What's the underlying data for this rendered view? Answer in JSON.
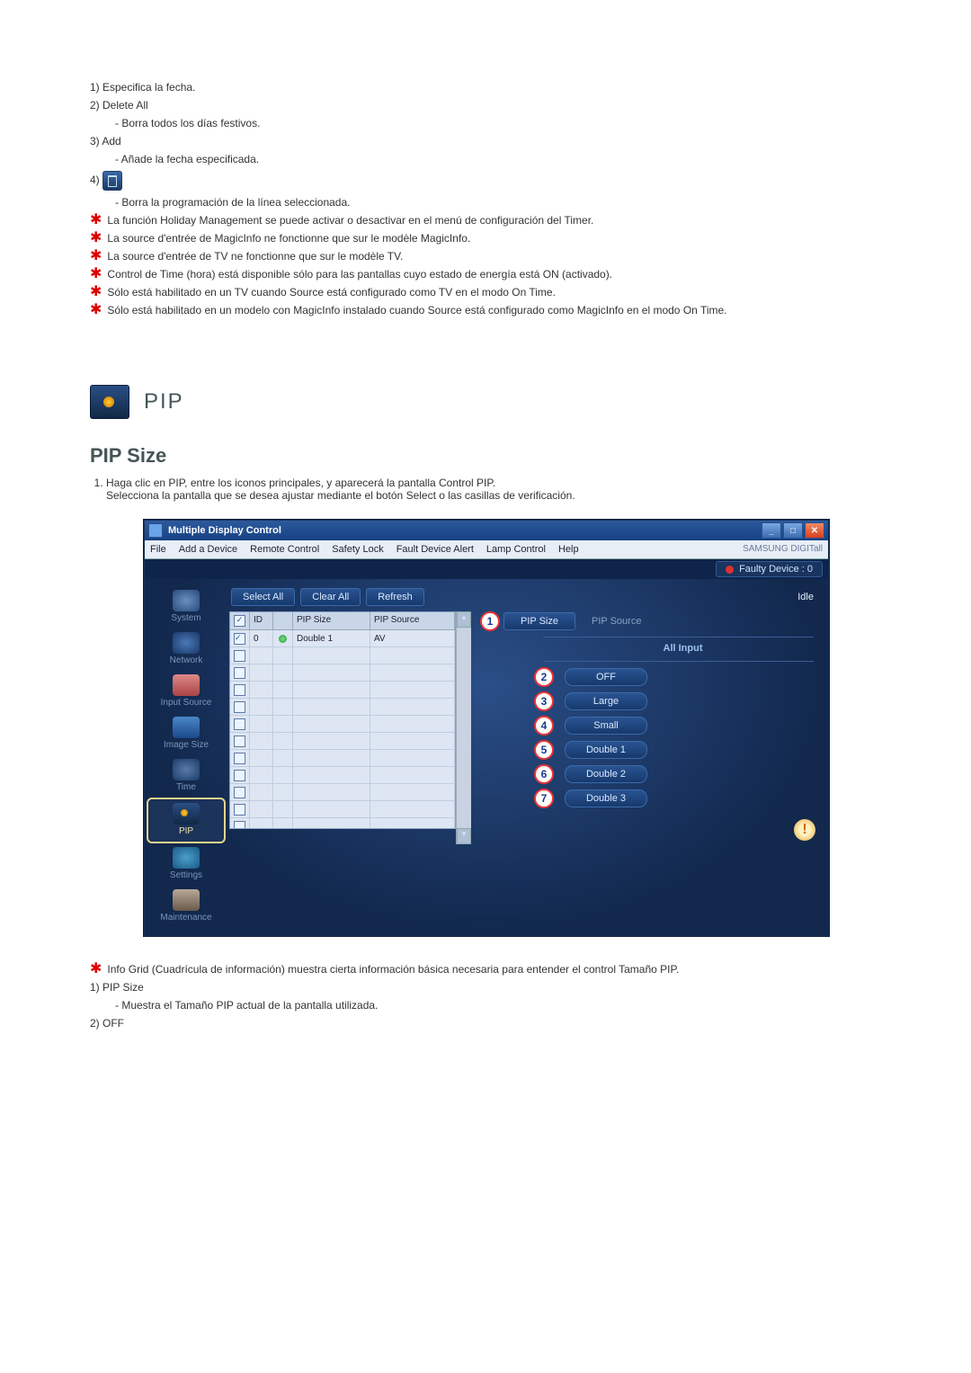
{
  "top_list": {
    "i1": "1) Especifica la fecha.",
    "i2": "2) Delete All",
    "i2s": "- Borra todos los días festivos.",
    "i3": "3) Add",
    "i3s": "- Añade la fecha especificada.",
    "i4": "4)",
    "i4s": "- Borra la programación de la línea seleccionada."
  },
  "top_stars": [
    "La función Holiday Management se puede activar o desactivar en el menú de configuración del Timer.",
    "La source d'entrée de MagicInfo ne fonctionne que sur le modèle MagicInfo.",
    "La source d'entrée de TV ne fonctionne que sur le modèle TV.",
    "Control de Time (hora) está disponible sólo para las pantallas cuyo estado de energía está ON (activado).",
    "Sólo está habilitado en un TV cuando Source está configurado como TV en el modo On Time.",
    "Sólo está habilitado en un modelo con MagicInfo instalado cuando Source está configurado como MagicInfo en el modo On Time."
  ],
  "pip_heading": "PIP",
  "pip_size_heading": "PIP Size",
  "steps": [
    "Haga clic en PIP, entre los iconos principales, y aparecerá la pantalla Control PIP.",
    "Selecciona la pantalla que se desea ajustar mediante el botón Select o las casillas de verificación."
  ],
  "app": {
    "title": "Multiple Display Control",
    "menu": [
      "File",
      "Add a Device",
      "Remote Control",
      "Safety Lock",
      "Fault Device Alert",
      "Lamp Control",
      "Help"
    ],
    "brand": "SAMSUNG DIGITall",
    "faulty": "Faulty Device : 0",
    "toolbar": {
      "select": "Select All",
      "clear": "Clear All",
      "refresh": "Refresh",
      "idle": "Idle"
    },
    "sidebar": [
      "System",
      "Network",
      "Input Source",
      "Image Size",
      "Time",
      "PIP",
      "Settings",
      "Maintenance"
    ],
    "grid": {
      "headers": {
        "id": "ID",
        "pipsize": "PIP Size",
        "pipsource": "PIP Source",
        "dot_tip": "✓"
      },
      "row": {
        "id": "0",
        "pipsize": "Double 1",
        "pipsource": "AV"
      }
    },
    "tabs": {
      "pipsize": "PIP Size",
      "pipsource": "PIP Source"
    },
    "allinput": "All Input",
    "options": [
      "OFF",
      "Large",
      "Small",
      "Double 1",
      "Double 2",
      "Double 3"
    ],
    "callouts": [
      "1",
      "2",
      "3",
      "4",
      "5",
      "6",
      "7"
    ]
  },
  "bottom_star": "Info Grid (Cuadrícula de información) muestra cierta información básica necesaria para entender el control Tamaño PIP.",
  "bottom": {
    "i1": "1) PIP Size",
    "i1s": "- Muestra el Tamaño PIP actual de la pantalla utilizada.",
    "i2": "2) OFF"
  }
}
